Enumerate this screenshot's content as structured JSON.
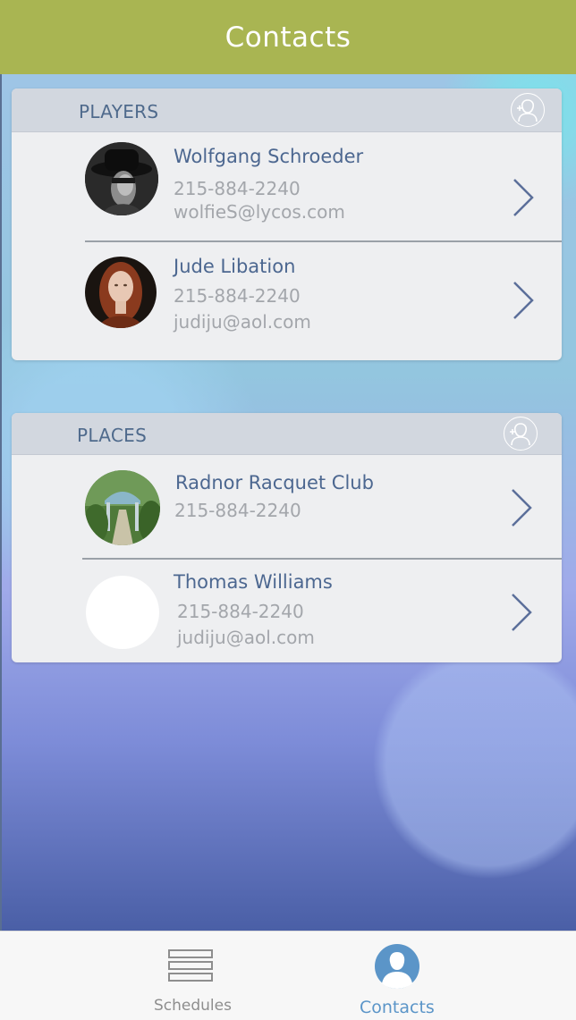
{
  "header": {
    "title": "Contacts"
  },
  "players": {
    "title": "PLAYERS",
    "items": [
      {
        "name": "Wolfgang Schroeder",
        "phone": "215-884-2240",
        "email": "wolfieS@lycos.com",
        "avatar": "man-in-hat-photo"
      },
      {
        "name": "Jude Libation",
        "phone": "215-884-2240",
        "email": "judiju@aol.com",
        "avatar": "red-haired-woman-photo"
      }
    ]
  },
  "places": {
    "title": "PLACES",
    "items": [
      {
        "name": "Radnor Racquet Club",
        "phone": "215-884-2240",
        "avatar": "garden-archway-photo"
      },
      {
        "name": "Thomas Williams",
        "phone": "215-884-2240",
        "email": "judiju@aol.com",
        "avatar": "blank-white-avatar"
      }
    ]
  },
  "tabbar": {
    "tabs": [
      {
        "label": "Schedules",
        "icon": "list-icon",
        "active": false
      },
      {
        "label": "Contacts",
        "icon": "person-icon",
        "active": true
      }
    ],
    "active_color": "#5b95c8",
    "inactive_color": "#8e8e8e"
  },
  "colors": {
    "header": "#a9b552",
    "card_bg": "#eeeff1",
    "card_header": "#d2d7df",
    "name_text": "#4c6790",
    "detail_text": "#a3a6ab"
  }
}
